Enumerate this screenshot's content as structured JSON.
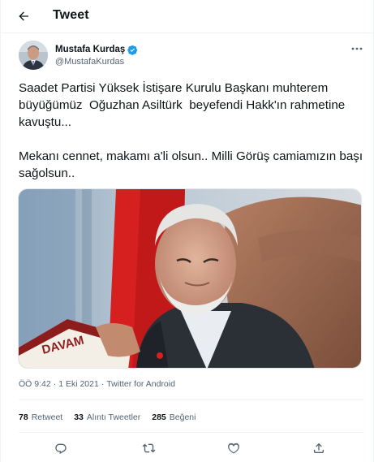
{
  "header": {
    "title": "Tweet",
    "back_icon": "arrow-left-icon"
  },
  "author": {
    "display_name": "Mustafa Kurdaş",
    "handle": "@MustafaKurdas",
    "verified_icon": "verified-badge-icon",
    "more_icon": "more-horizontal-icon"
  },
  "tweet": {
    "text": "Saadet Partisi Yüksek İstişare Kurulu Başkanı muhterem büyüğümüz  Oğuzhan Asiltürk  beyefendi Hakk'ın rahmetine kavuştu...\n\nMekanı cennet, makamı a'li olsun.. Milli Görüş camiamızın başı sağolsun..",
    "image_caption_text": "DAVAM"
  },
  "meta": {
    "time": "ÖÖ 9:42",
    "date": "1 Eki 2021",
    "separator": "·",
    "source": "Twitter for Android"
  },
  "stats": [
    {
      "count": "78",
      "label": "Retweet"
    },
    {
      "count": "33",
      "label": "Alıntı Tweetler"
    },
    {
      "count": "285",
      "label": "Beğeni"
    }
  ],
  "actions": [
    "reply-icon",
    "retweet-icon",
    "like-icon",
    "share-icon"
  ],
  "colors": {
    "text": "#0f1419",
    "secondary": "#536471",
    "divider": "#eff3f4",
    "verified": "#1d9bf0"
  }
}
